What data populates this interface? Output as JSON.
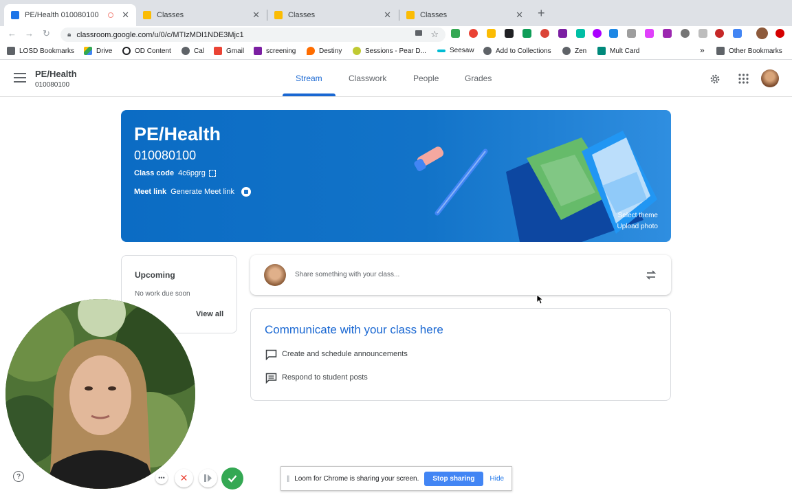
{
  "browser": {
    "tabs": [
      {
        "title": "PE/Health 010080100"
      },
      {
        "title": "Classes"
      },
      {
        "title": "Classes"
      },
      {
        "title": "Classes"
      }
    ],
    "new_tab": "+",
    "url": "classroom.google.com/u/0/c/MTIzMDI1NDE3Mjc1"
  },
  "bookmarks": {
    "items": [
      "LOSD Bookmarks",
      "Drive",
      "OD Content",
      "Cal",
      "Gmail",
      "screening",
      "Destiny",
      "Sessions - Pear D...",
      "Seesaw",
      "Add to Collections",
      "Zen",
      "Mult Card"
    ],
    "overflow": "»",
    "other": "Other Bookmarks"
  },
  "header": {
    "class_name": "PE/Health",
    "section": "010080100",
    "tabs": [
      "Stream",
      "Classwork",
      "People",
      "Grades"
    ]
  },
  "banner": {
    "title": "PE/Health",
    "subtitle": "010080100",
    "class_code_label": "Class code",
    "class_code": "4c6pgrg",
    "meet_label": "Meet link",
    "meet_value": "Generate Meet link",
    "select_theme": "Select theme",
    "upload_photo": "Upload photo"
  },
  "upcoming": {
    "title": "Upcoming",
    "text": "No work due soon",
    "view_all": "View all"
  },
  "share": {
    "placeholder": "Share something with your class..."
  },
  "communicate": {
    "title": "Communicate with your class here",
    "items": [
      "Create and schedule announcements",
      "Respond to student posts"
    ]
  },
  "loom": {
    "message": "Loom for Chrome is sharing your screen.",
    "stop": "Stop sharing",
    "hide": "Hide"
  },
  "colors": {
    "accent": "#1967d2",
    "banner": "#1a73c9",
    "loom_button": "#4285f4",
    "record_green": "#34a853"
  }
}
